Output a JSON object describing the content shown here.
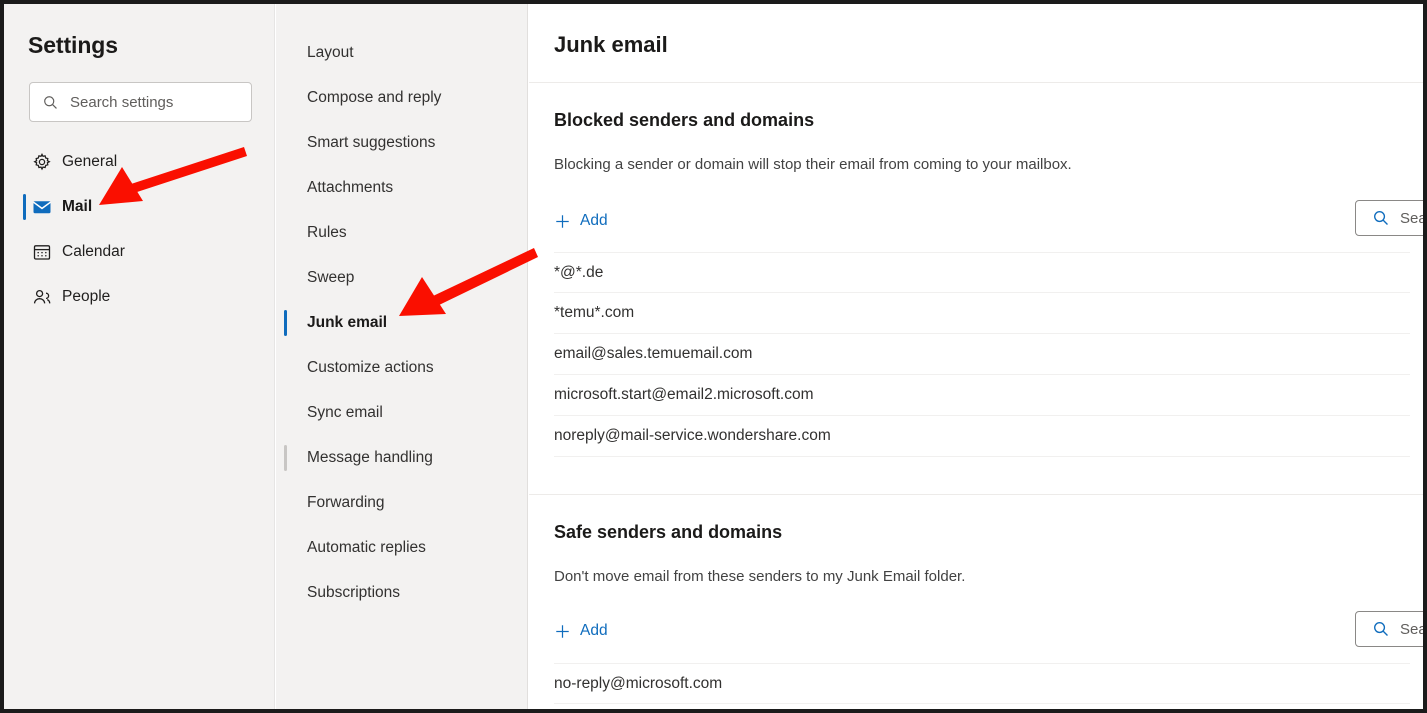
{
  "sidebar": {
    "title": "Settings",
    "search": {
      "placeholder": "Search settings",
      "value": "",
      "icon": "search-icon"
    },
    "items": [
      {
        "label": "General",
        "icon": "gear-icon",
        "selected": false
      },
      {
        "label": "Mail",
        "icon": "envelope-icon",
        "selected": true
      },
      {
        "label": "Calendar",
        "icon": "calendar-icon",
        "selected": false
      },
      {
        "label": "People",
        "icon": "people-icon",
        "selected": false
      }
    ]
  },
  "subnav": {
    "items": [
      {
        "label": "Layout",
        "state": "normal"
      },
      {
        "label": "Compose and reply",
        "state": "normal"
      },
      {
        "label": "Smart suggestions",
        "state": "normal"
      },
      {
        "label": "Attachments",
        "state": "normal"
      },
      {
        "label": "Rules",
        "state": "normal"
      },
      {
        "label": "Sweep",
        "state": "normal"
      },
      {
        "label": "Junk email",
        "state": "selected"
      },
      {
        "label": "Customize actions",
        "state": "normal"
      },
      {
        "label": "Sync email",
        "state": "normal"
      },
      {
        "label": "Message handling",
        "state": "hovered"
      },
      {
        "label": "Forwarding",
        "state": "normal"
      },
      {
        "label": "Automatic replies",
        "state": "normal"
      },
      {
        "label": "Subscriptions",
        "state": "normal"
      }
    ]
  },
  "main": {
    "title": "Junk email",
    "blocked": {
      "heading": "Blocked senders and domains",
      "description": "Blocking a sender or domain will stop their email from coming to your mailbox.",
      "add_label": "Add",
      "add_icon": "plus-icon",
      "search": {
        "placeholder": "Search",
        "value": "",
        "icon": "search-icon"
      },
      "entries": [
        "*@*.de",
        "*temu*.com",
        "email@sales.temuemail.com",
        "microsoft.start@email2.microsoft.com",
        "noreply@mail-service.wondershare.com"
      ]
    },
    "safe": {
      "heading": "Safe senders and domains",
      "description": "Don't move email from these senders to my Junk Email folder.",
      "add_label": "Add",
      "add_icon": "plus-icon",
      "search": {
        "placeholder": "Search",
        "value": "",
        "icon": "search-icon"
      },
      "entries": [
        "no-reply@microsoft.com"
      ]
    }
  },
  "annotations": {
    "arrow_color": "#fa0f00",
    "arrows": [
      {
        "name": "arrow-pointing-to-mail",
        "points_to": "Mail"
      },
      {
        "name": "arrow-pointing-to-junk-email",
        "points_to": "Junk email"
      }
    ]
  },
  "colors": {
    "accent": "#0f6cbd",
    "sidebar_bg": "#f3f2f1",
    "content_bg": "#ffffff",
    "text": "#1b1a19",
    "arrow_red": "#fa0f00"
  }
}
